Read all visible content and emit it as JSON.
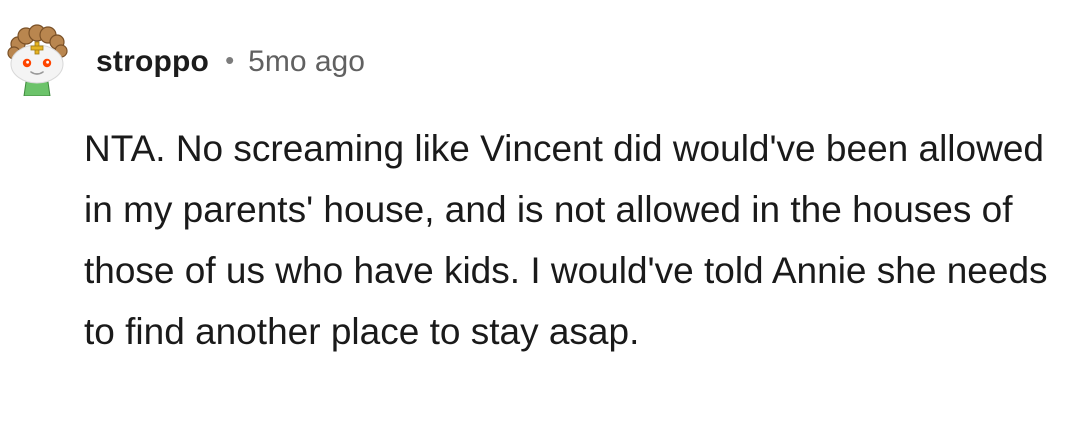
{
  "comment": {
    "author": "stroppo",
    "separator": "•",
    "time_ago": "5mo ago",
    "body": "NTA. No screaming like Vincent did would've been allowed in my parents' house, and is not allowed in the houses of those of us who have kids. I would've told Annie she needs to find another place to stay asap.",
    "avatar_icon": "reddit-snoo-avatar-icon"
  }
}
